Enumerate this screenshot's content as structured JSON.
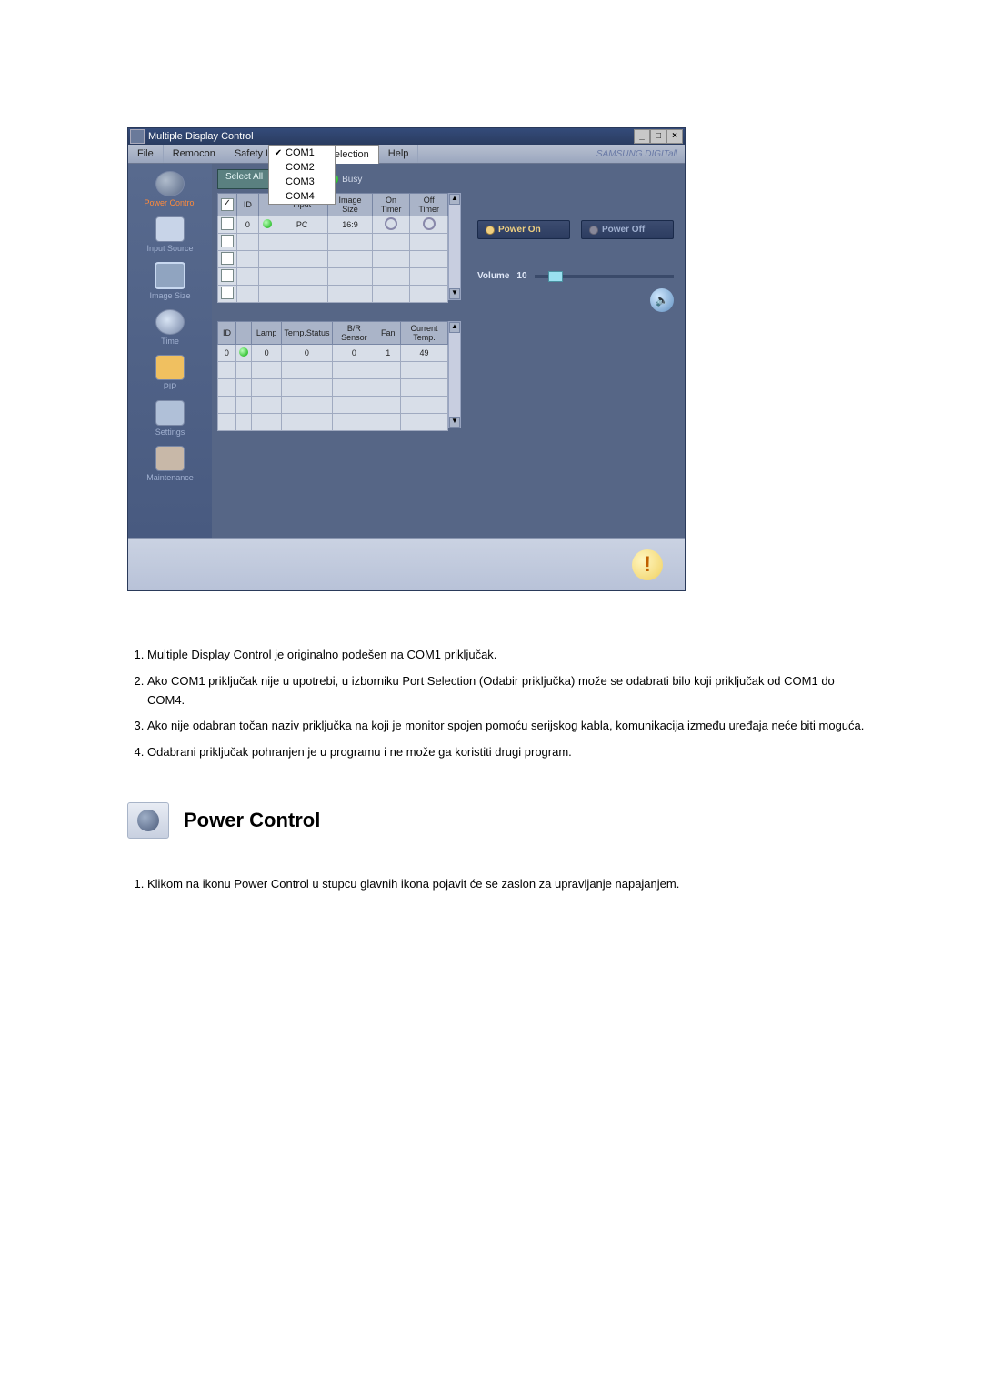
{
  "window": {
    "title": "Multiple Display Control",
    "min": "_",
    "max": "□",
    "close": "×"
  },
  "menu": {
    "file": "File",
    "remocon": "Remocon",
    "safety_lock": "Safety Lock",
    "port_selection": "Port Selection",
    "help": "Help",
    "brand": "SAMSUNG DIGITall"
  },
  "port_dropdown": [
    "COM1",
    "COM2",
    "COM3",
    "COM4"
  ],
  "sidebar": {
    "items": [
      {
        "label": "Power Control"
      },
      {
        "label": "Input Source"
      },
      {
        "label": "Image Size"
      },
      {
        "label": "Time"
      },
      {
        "label": "PIP"
      },
      {
        "label": "Settings"
      },
      {
        "label": "Maintenance"
      }
    ]
  },
  "toolbar": {
    "select_all": "Select All",
    "busy": "Busy"
  },
  "upper_table": {
    "headers": [
      "",
      "ID",
      "",
      "Input",
      "Image Size",
      "On Timer",
      "Off Timer"
    ],
    "rows": [
      {
        "checked": false,
        "id": "0",
        "status": "green",
        "input": "PC",
        "image_size": "16:9",
        "on_timer": "○",
        "off_timer": "○"
      },
      {
        "checked": false,
        "id": "",
        "status": "",
        "input": "",
        "image_size": "",
        "on_timer": "",
        "off_timer": ""
      },
      {
        "checked": false,
        "id": "",
        "status": "",
        "input": "",
        "image_size": "",
        "on_timer": "",
        "off_timer": ""
      },
      {
        "checked": false,
        "id": "",
        "status": "",
        "input": "",
        "image_size": "",
        "on_timer": "",
        "off_timer": ""
      },
      {
        "checked": false,
        "id": "",
        "status": "",
        "input": "",
        "image_size": "",
        "on_timer": "",
        "off_timer": ""
      }
    ]
  },
  "lower_table": {
    "headers": [
      "ID",
      "",
      "Lamp",
      "Temp.Status",
      "B/R Sensor",
      "Fan",
      "Current Temp."
    ],
    "rows": [
      {
        "id": "0",
        "status": "green",
        "lamp": "0",
        "temp_status": "0",
        "br_sensor": "0",
        "fan": "1",
        "current_temp": "49"
      },
      {
        "id": "",
        "status": "",
        "lamp": "",
        "temp_status": "",
        "br_sensor": "",
        "fan": "",
        "current_temp": ""
      },
      {
        "id": "",
        "status": "",
        "lamp": "",
        "temp_status": "",
        "br_sensor": "",
        "fan": "",
        "current_temp": ""
      },
      {
        "id": "",
        "status": "",
        "lamp": "",
        "temp_status": "",
        "br_sensor": "",
        "fan": "",
        "current_temp": ""
      },
      {
        "id": "",
        "status": "",
        "lamp": "",
        "temp_status": "",
        "br_sensor": "",
        "fan": "",
        "current_temp": ""
      }
    ]
  },
  "right_panel": {
    "power_on": "Power On",
    "power_off": "Power Off",
    "volume_label": "Volume",
    "volume_value": "10"
  },
  "doc": {
    "list1": [
      "Multiple Display Control je originalno podešen na COM1 priključak.",
      "Ako COM1 priključak nije u upotrebi, u izborniku Port Selection (Odabir priključka) može se odabrati bilo koji priključak od COM1 do COM4.",
      "Ako nije odabran točan naziv priključka na koji je monitor spojen pomoću serijskog kabla, komunikacija između uređaja neće biti moguća.",
      "Odabrani priključak pohranjen je u programu i ne može ga koristiti drugi program."
    ],
    "section_title": "Power Control",
    "list2": [
      "Klikom na ikonu Power Control u stupcu glavnih ikona pojavit će se zaslon za upravljanje napajanjem."
    ]
  }
}
